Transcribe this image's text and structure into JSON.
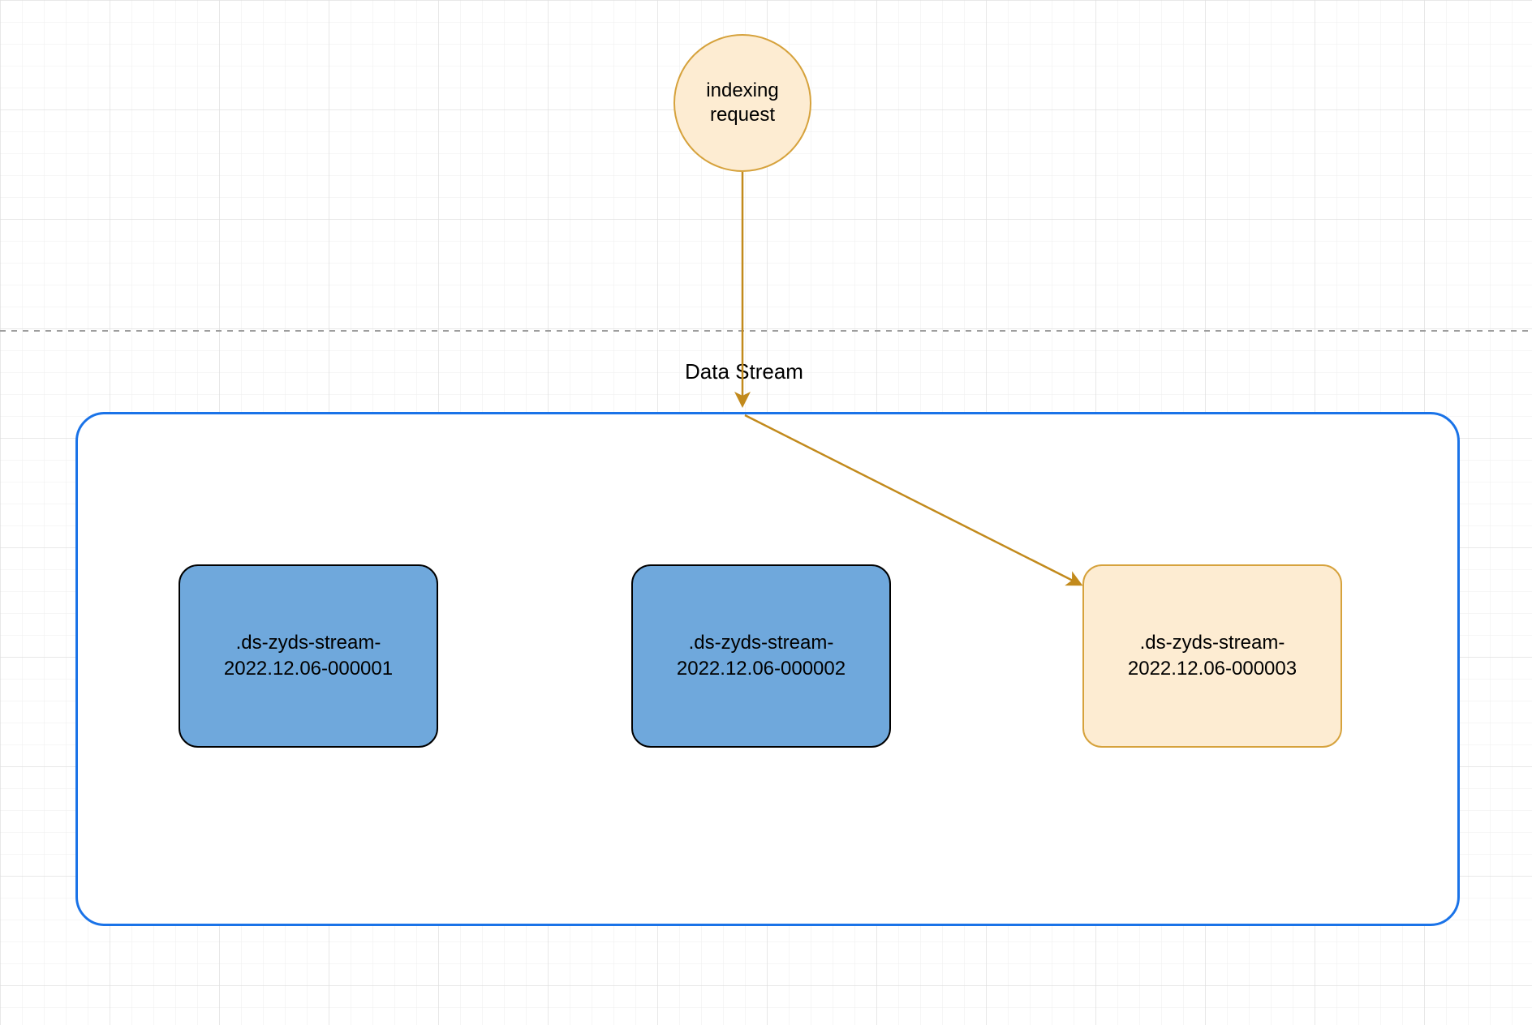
{
  "colors": {
    "grid_minor": "#EDEDED",
    "grid_major": "#E0E0E0",
    "dashed_line": "#9E9E9E",
    "arrow": "#C28A1C",
    "circle_fill": "#FDECD2",
    "circle_stroke": "#D6A23C",
    "container_stroke": "#1A73E8",
    "box_blue_fill": "#6FA8DC",
    "box_orange_fill": "#FDECD2",
    "box_orange_stroke": "#D6A23C"
  },
  "nodes": {
    "indexing_request": {
      "line1": "indexing",
      "line2": "request"
    },
    "data_stream_label": "Data Stream",
    "indices": [
      {
        "line1": ".ds-zyds-stream-",
        "line2": "2022.12.06-000001",
        "variant": "blue"
      },
      {
        "line1": ".ds-zyds-stream-",
        "line2": "2022.12.06-000002",
        "variant": "blue"
      },
      {
        "line1": ".ds-zyds-stream-",
        "line2": "2022.12.06-000003",
        "variant": "orange"
      }
    ]
  }
}
